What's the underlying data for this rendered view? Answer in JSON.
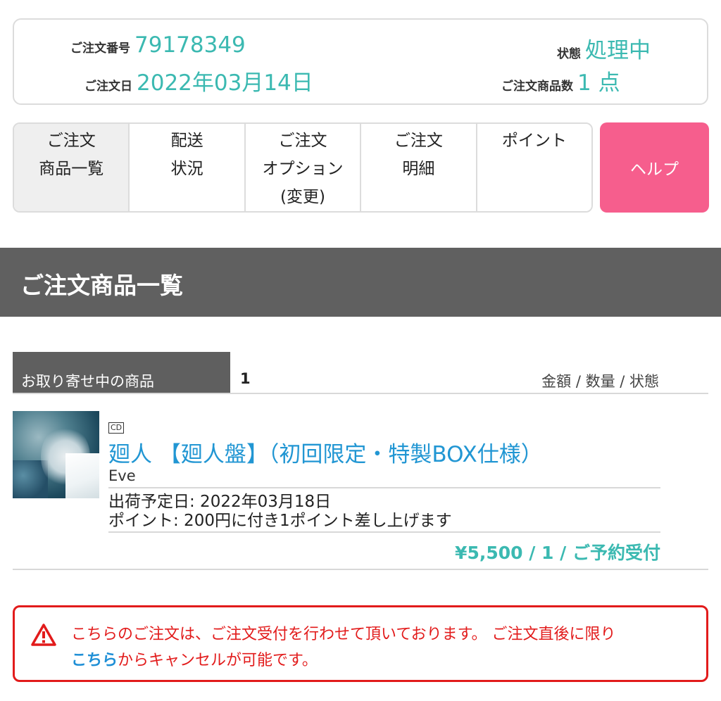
{
  "order": {
    "number_label": "ご注文番号",
    "number": "79178349",
    "date_label": "ご注文日",
    "date": "2022年03月14日",
    "status_label": "状態",
    "status": "処理中",
    "count_label": "ご注文商品数",
    "count": "1 点"
  },
  "tabs": [
    {
      "line1": "ご注文",
      "line2": "商品一覧",
      "line3": ""
    },
    {
      "line1": "配送",
      "line2": "状況",
      "line3": ""
    },
    {
      "line1": "ご注文",
      "line2": "オプション",
      "line3": "(変更)"
    },
    {
      "line1": "ご注文",
      "line2": "明細",
      "line3": ""
    },
    {
      "line1": "ポイント",
      "line2": "",
      "line3": ""
    }
  ],
  "help_label": "ヘルプ",
  "section_title": "ご注文商品一覧",
  "list_header": {
    "tab_label": "お取り寄せ中の商品",
    "count": "1",
    "right_label": "金額 / 数量 / 状態"
  },
  "product": {
    "format_badge": "CD",
    "title": "廻人 【廻人盤】（初回限定・特製BOX仕様）",
    "artist": "Eve",
    "ship_date": "出荷予定日: 2022年03月18日",
    "points": "ポイント: 200円に付き1ポイント差し上げます",
    "price_line": "¥5,500 / 1 / ご予約受付"
  },
  "notice": {
    "text1": "こちらのご注文は、ご注文受付を行わせて頂いております。 ご注文直後に限り",
    "link": "こちら",
    "text2": "からキャンセルが可能です。",
    "color": "#e21b1b"
  },
  "colors": {
    "accent": "#3bb9b1",
    "help": "#f65e8d",
    "link": "#2196d3"
  }
}
